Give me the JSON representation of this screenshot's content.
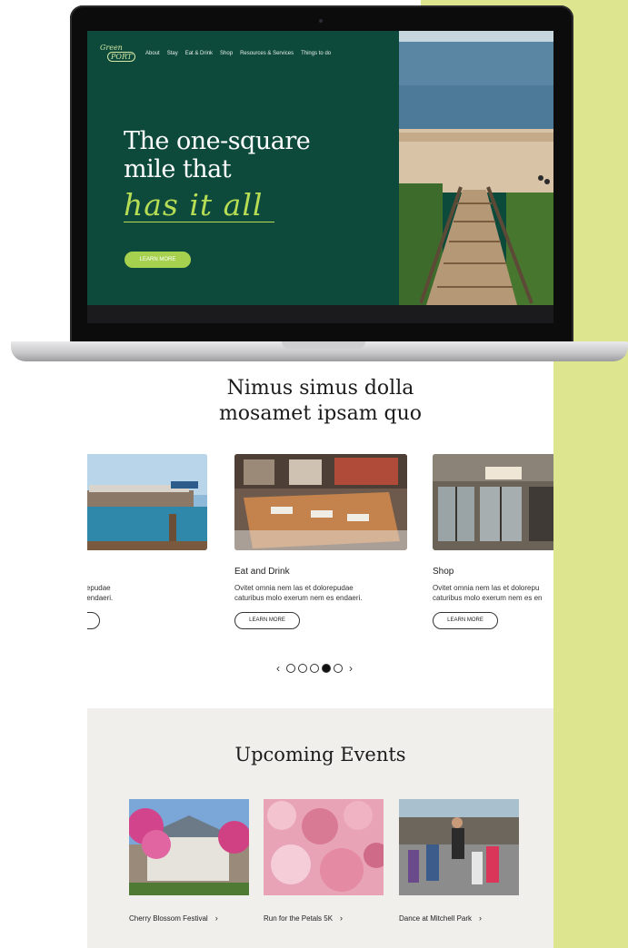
{
  "site": {
    "logo_line1": "Green",
    "logo_line2": "PORT"
  },
  "nav": {
    "items": [
      "About",
      "Stay",
      "Eat & Drink",
      "Shop",
      "Resources & Services",
      "Things to do"
    ]
  },
  "hero": {
    "title_line1": "The one-square",
    "title_line2": "mile that",
    "title_script": "has it all",
    "button": "LEARN MORE"
  },
  "categories": {
    "title_line1": "Nimus simus dolla",
    "title_line2": "mosamet ipsam quo",
    "cards": [
      {
        "name": "",
        "desc1": "nem las et dolorepudae",
        "desc2": "exerum nem es endaeri.",
        "button": ""
      },
      {
        "name": "Eat and Drink",
        "desc1": "Ovitet omnia nem las et dolorepudae",
        "desc2": "caturibus molo exerum nem es endaeri.",
        "button": "LEARN MORE"
      },
      {
        "name": "Shop",
        "desc1": "Ovitet omnia nem las et dolorepu",
        "desc2": "caturibus molo exerum nem es en",
        "button": "LEARN MORE"
      }
    ],
    "pager": {
      "prev": "‹",
      "next": "›",
      "total": 5,
      "active_index": 3
    }
  },
  "events": {
    "title": "Upcoming Events",
    "items": [
      {
        "label": "Cherry Blossom Festival"
      },
      {
        "label": "Run for the Petals 5K"
      },
      {
        "label": "Dance at Mitchell Park"
      }
    ]
  },
  "colors": {
    "hero_green": "#0d4a3c",
    "accent_lime": "#a6d14f",
    "panel_lime": "#dde68f",
    "events_bg": "#f1efeb"
  }
}
